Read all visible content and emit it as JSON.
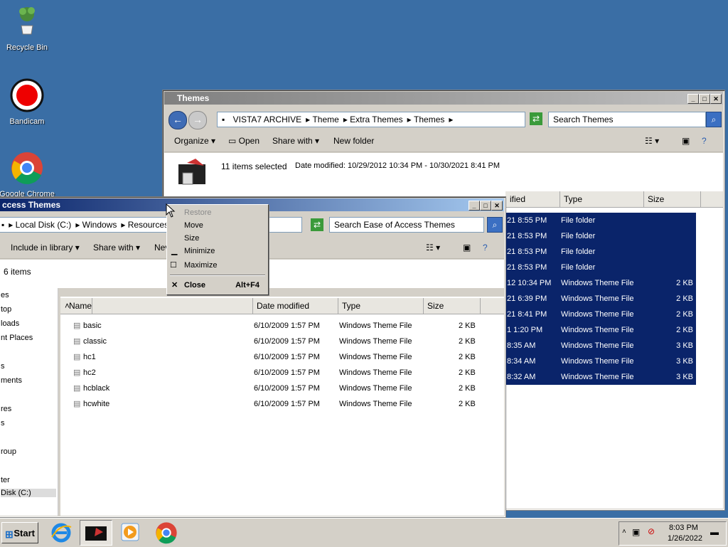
{
  "desktop": {
    "icons": [
      {
        "label": "Recycle Bin"
      },
      {
        "label": "Bandicam"
      },
      {
        "label": "Google Chrome"
      }
    ]
  },
  "themes_window": {
    "title": "Themes",
    "breadcrumb": [
      "VISTA7 ARCHIVE",
      "Theme",
      "Extra Themes",
      "Themes"
    ],
    "search_placeholder": "Search Themes",
    "toolbar": {
      "organize": "Organize",
      "open": "Open",
      "share_with": "Share with",
      "new_folder": "New folder"
    },
    "details": {
      "selection": "11 items selected",
      "date_label": "Date modified:",
      "date_range": "10/29/2012 10:34 PM - 10/30/2021 8:41 PM"
    },
    "columns": {
      "date": "ified",
      "type": "Type",
      "size": "Size"
    },
    "rows": [
      {
        "date": "21 8:55 PM",
        "type": "File folder",
        "size": ""
      },
      {
        "date": "21 8:53 PM",
        "type": "File folder",
        "size": ""
      },
      {
        "date": "21 8:53 PM",
        "type": "File folder",
        "size": ""
      },
      {
        "date": "21 8:53 PM",
        "type": "File folder",
        "size": ""
      },
      {
        "date": "12 10:34 PM",
        "type": "Windows Theme File",
        "size": "2 KB"
      },
      {
        "date": "21 6:39 PM",
        "type": "Windows Theme File",
        "size": "2 KB"
      },
      {
        "date": "21 8:41 PM",
        "type": "Windows Theme File",
        "size": "2 KB"
      },
      {
        "date": "1 1:20 PM",
        "type": "Windows Theme File",
        "size": "2 KB"
      },
      {
        "date": "8:35 AM",
        "type": "Windows Theme File",
        "size": "3 KB"
      },
      {
        "date": "8:34 AM",
        "type": "Windows Theme File",
        "size": "3 KB"
      },
      {
        "date": "8:32 AM",
        "type": "Windows Theme File",
        "size": "3 KB"
      }
    ]
  },
  "ease_window": {
    "title": "ccess Themes",
    "breadcrumb": [
      "Local Disk (C:)",
      "Windows",
      "Resources"
    ],
    "search_placeholder": "Search Ease of Access Themes",
    "toolbar": {
      "include": "Include in library",
      "share_with": "Share with",
      "new": "Nev"
    },
    "details": {
      "count": "6 items"
    },
    "columns": {
      "name": "Name",
      "date": "Date modified",
      "type": "Type",
      "size": "Size"
    },
    "nav": [
      "es",
      "top",
      "loads",
      "nt Places",
      "s",
      "ments",
      "",
      "res",
      "s",
      "roup",
      "ter",
      "Disk (C:)"
    ],
    "files": [
      {
        "name": "basic",
        "date": "6/10/2009 1:57 PM",
        "type": "Windows Theme File",
        "size": "2 KB"
      },
      {
        "name": "classic",
        "date": "6/10/2009 1:57 PM",
        "type": "Windows Theme File",
        "size": "2 KB"
      },
      {
        "name": "hc1",
        "date": "6/10/2009 1:57 PM",
        "type": "Windows Theme File",
        "size": "2 KB"
      },
      {
        "name": "hc2",
        "date": "6/10/2009 1:57 PM",
        "type": "Windows Theme File",
        "size": "2 KB"
      },
      {
        "name": "hcblack",
        "date": "6/10/2009 1:57 PM",
        "type": "Windows Theme File",
        "size": "2 KB"
      },
      {
        "name": "hcwhite",
        "date": "6/10/2009 1:57 PM",
        "type": "Windows Theme File",
        "size": "2 KB"
      }
    ]
  },
  "context_menu": {
    "items": [
      {
        "label": "Restore",
        "shortcut": ""
      },
      {
        "label": "Move",
        "shortcut": ""
      },
      {
        "label": "Size",
        "shortcut": ""
      },
      {
        "label": "Minimize",
        "shortcut": ""
      },
      {
        "label": "Maximize",
        "shortcut": ""
      },
      {
        "label": "Close",
        "shortcut": "Alt+F4"
      }
    ]
  },
  "taskbar": {
    "start_label": "Start",
    "time": "8:03 PM",
    "date": "1/26/2022"
  },
  "colors": {
    "desktop": "#3a6ea5",
    "selection": "#0a246a",
    "title_active": "#0a246a"
  }
}
